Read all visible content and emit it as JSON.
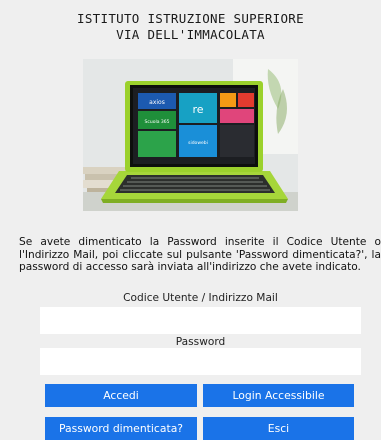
{
  "header": {
    "line1": "ISTITUTO ISTRUZIONE SUPERIORE",
    "line2": "VIA DELL'IMMACOLATA"
  },
  "hero_tiles": {
    "tile1": "axios",
    "tile2": "Scuola 365",
    "tile3": "re",
    "tile4": "sidowebi"
  },
  "info_text": "Se avete dimenticato la Password inserite il Codice Utente o l'Indirizzo Mail, poi cliccate sul pulsante 'Password dimenticata?', la password di accesso sarà inviata all'indirizzo che avete indicato.",
  "form": {
    "user_label": "Codice Utente / Indirizzo Mail",
    "user_value": "",
    "password_label": "Password",
    "password_value": ""
  },
  "buttons": {
    "login": "Accedi",
    "accessible_login": "Login Accessibile",
    "forgot_password": "Password dimenticata?",
    "exit": "Esci"
  },
  "colors": {
    "button": "#1a73e8",
    "background": "#efefef",
    "laptop_body": "#9bd12c"
  }
}
